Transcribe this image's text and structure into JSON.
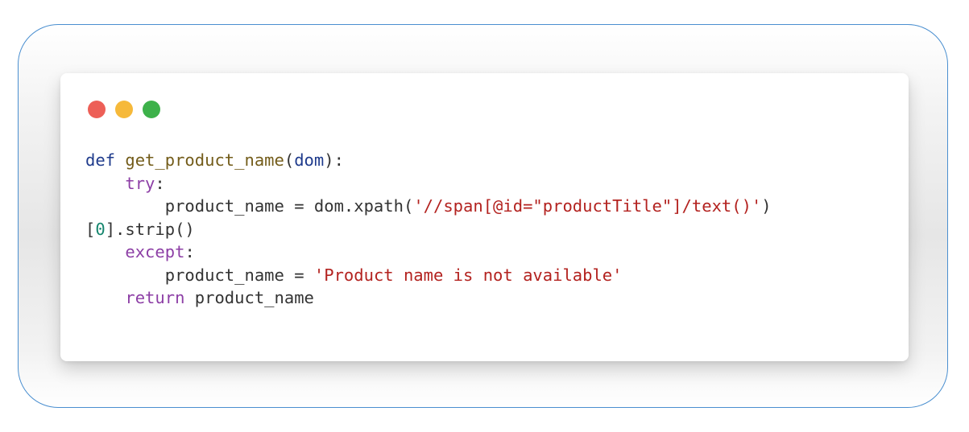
{
  "window": {
    "buttons": [
      {
        "name": "close",
        "color": "#ed5f57"
      },
      {
        "name": "minimize",
        "color": "#f6b93a"
      },
      {
        "name": "maximize",
        "color": "#3db14a"
      }
    ]
  },
  "code": {
    "line1": {
      "kw": "def",
      "fn": "get_product_name",
      "open": "(",
      "param": "dom",
      "close": "):"
    },
    "line2": {
      "indent": "    ",
      "kw": "try",
      "colon": ":"
    },
    "line3": {
      "indent": "        ",
      "lhs": "product_name = dom.xpath(",
      "str": "'//span[@id=\"productTitle\"]/text()'",
      "close": ")"
    },
    "line4": {
      "open": "[",
      "num": "0",
      "rest": "].strip()"
    },
    "line5": {
      "indent": "    ",
      "kw": "except",
      "colon": ":"
    },
    "line6": {
      "indent": "        ",
      "lhs": "product_name = ",
      "str": "'Product name is not available'"
    },
    "line7": {
      "indent": "    ",
      "kw": "return",
      "rest": " product_name"
    }
  },
  "colors": {
    "frame_border": "#4a8fd0",
    "keyword_blue": "#1f3b8c",
    "keyword_purple": "#8d3fa6",
    "function_name": "#735c1a",
    "string": "#b3221f",
    "number": "#16866e"
  }
}
